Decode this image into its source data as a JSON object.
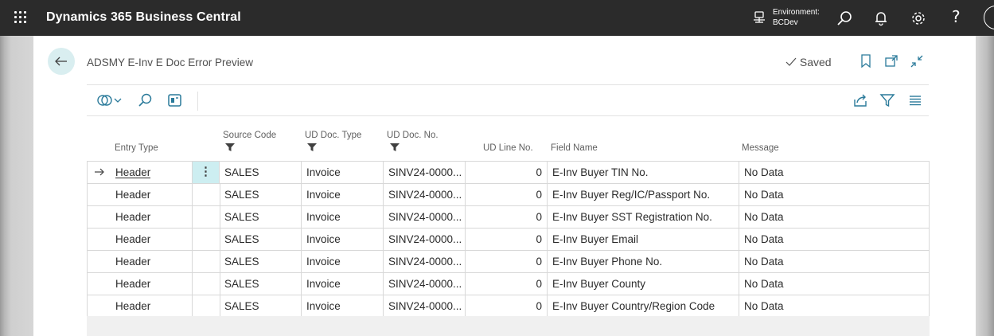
{
  "topbar": {
    "app_title": "Dynamics 365 Business Central",
    "environment_label": "Environment:",
    "environment_value": "BCDev",
    "icons": [
      "waffle-icon",
      "environment-icon",
      "search-icon",
      "bell-icon",
      "gear-icon",
      "help-icon"
    ],
    "help_glyph": "?"
  },
  "page": {
    "title": "ADSMY E-Inv E Doc Error Preview",
    "saved_label": "Saved",
    "header_icons": [
      "bookmark-icon",
      "open-new-window-icon",
      "collapse-icon"
    ],
    "action_icons": [
      "analyze-icon",
      "search-icon",
      "edit-in-excel-icon",
      "share-icon",
      "filter-icon",
      "list-view-icon"
    ]
  },
  "columns": {
    "entry_type": "Entry Type",
    "source_code": "Source Code",
    "ud_doc_type": "UD Doc. Type",
    "ud_doc_no": "UD Doc. No.",
    "ud_line_no": "UD Line No.",
    "field_name": "Field Name",
    "message": "Message"
  },
  "rows": [
    {
      "entry_type": "Header",
      "source_code": "SALES",
      "ud_doc_type": "Invoice",
      "ud_doc_no": "SINV24-0000...",
      "ud_line_no": "0",
      "field_name": "E-Inv Buyer TIN No.",
      "message": "No Data"
    },
    {
      "entry_type": "Header",
      "source_code": "SALES",
      "ud_doc_type": "Invoice",
      "ud_doc_no": "SINV24-0000...",
      "ud_line_no": "0",
      "field_name": "E-Inv Buyer Reg/IC/Passport No.",
      "message": "No Data"
    },
    {
      "entry_type": "Header",
      "source_code": "SALES",
      "ud_doc_type": "Invoice",
      "ud_doc_no": "SINV24-0000...",
      "ud_line_no": "0",
      "field_name": "E-Inv Buyer SST Registration No.",
      "message": "No Data"
    },
    {
      "entry_type": "Header",
      "source_code": "SALES",
      "ud_doc_type": "Invoice",
      "ud_doc_no": "SINV24-0000...",
      "ud_line_no": "0",
      "field_name": "E-Inv Buyer Email",
      "message": "No Data"
    },
    {
      "entry_type": "Header",
      "source_code": "SALES",
      "ud_doc_type": "Invoice",
      "ud_doc_no": "SINV24-0000...",
      "ud_line_no": "0",
      "field_name": "E-Inv Buyer Phone No.",
      "message": "No Data"
    },
    {
      "entry_type": "Header",
      "source_code": "SALES",
      "ud_doc_type": "Invoice",
      "ud_doc_no": "SINV24-0000...",
      "ud_line_no": "0",
      "field_name": "E-Inv Buyer County",
      "message": "No Data"
    },
    {
      "entry_type": "Header",
      "source_code": "SALES",
      "ud_doc_type": "Invoice",
      "ud_doc_no": "SINV24-0000...",
      "ud_line_no": "0",
      "field_name": "E-Inv Buyer Country/Region Code",
      "message": "No Data"
    }
  ],
  "row_menu_glyph": "⋮",
  "colors": {
    "topbar": "#2b2b2b",
    "accent": "#cdeef1",
    "back_button": "#d9eef0"
  }
}
